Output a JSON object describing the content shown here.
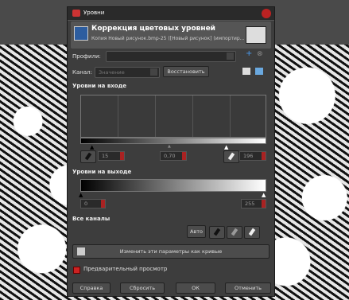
{
  "dialog": {
    "window_title": "Уровни",
    "header_title": "Коррекция цветовых уровней",
    "header_subtitle": "Копия Новый рисунок.bmp-25 ([Новый рисунок] (импортир...",
    "profile_label": "Профили:",
    "channel_label": "Канал:",
    "channel_value": "Значение",
    "reset_channel_label": "Восстановить",
    "input_levels_label": "Уровни на входе",
    "input_low": "15",
    "input_gamma": "0,70",
    "input_high": "196",
    "output_levels_label": "Уровни на выходе",
    "output_low": "0",
    "output_high": "255",
    "all_channels_label": "Все каналы",
    "auto_label": "Авто",
    "curves_label": "Изменить эти параметры как кривые",
    "preview_label": "Предварительный просмотр",
    "help_label": "Справка",
    "reset_label": "Сбросить",
    "ok_label": "ОК",
    "cancel_label": "Отменить"
  },
  "icons": [
    "eyedropper-icon",
    "add-icon",
    "delete-icon",
    "linear-histogram-icon",
    "log-histogram-icon"
  ]
}
